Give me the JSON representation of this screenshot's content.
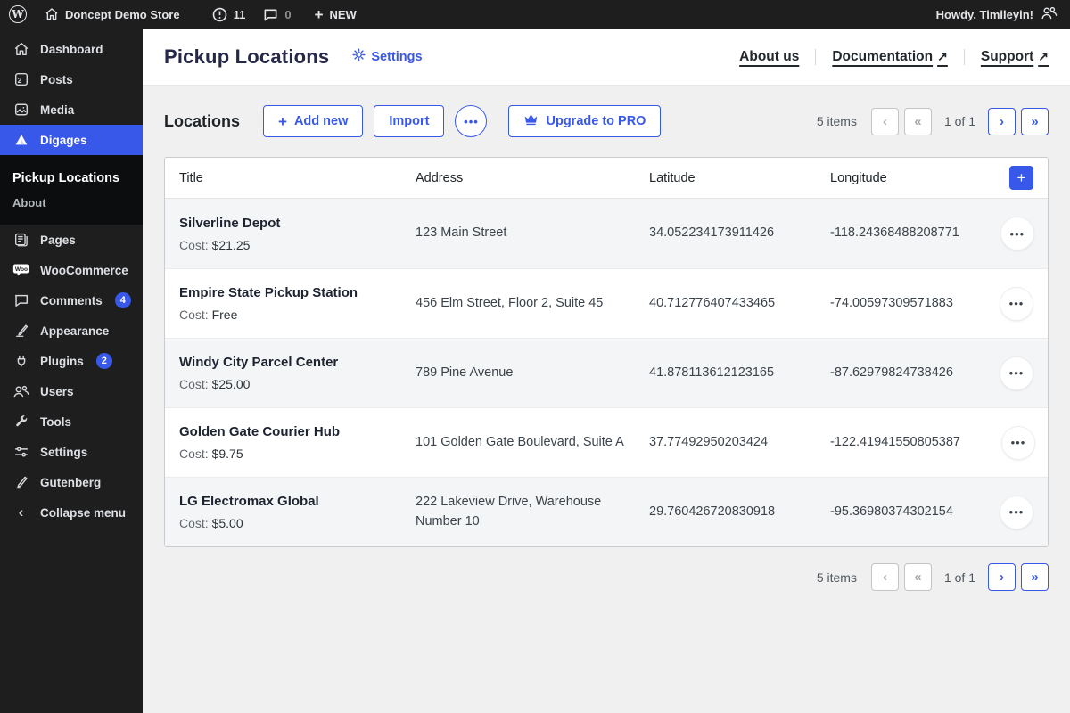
{
  "admin_bar": {
    "wp_logo": "W",
    "site_name": "Doncept Demo Store",
    "updates_count": "11",
    "comments_count": "0",
    "new_label": "NEW",
    "howdy": "Howdy, Timileyin!"
  },
  "sidebar": {
    "items": [
      {
        "label": "Dashboard"
      },
      {
        "label": "Posts"
      },
      {
        "label": "Media"
      },
      {
        "label": "Digages"
      },
      {
        "label": "Pages"
      },
      {
        "label": "WooCommerce"
      },
      {
        "label": "Comments",
        "badge": "4"
      },
      {
        "label": "Appearance"
      },
      {
        "label": "Plugins",
        "badge": "2"
      },
      {
        "label": "Users"
      },
      {
        "label": "Tools"
      },
      {
        "label": "Settings"
      },
      {
        "label": "Gutenberg"
      },
      {
        "label": "Collapse menu"
      }
    ],
    "submenu": [
      {
        "label": "Pickup Locations"
      },
      {
        "label": "About"
      }
    ]
  },
  "header": {
    "title": "Pickup Locations",
    "settings_label": "Settings",
    "nav": [
      {
        "label": "About us"
      },
      {
        "label": "Documentation"
      },
      {
        "label": "Support"
      }
    ]
  },
  "toolbar": {
    "heading": "Locations",
    "add_new_label": "Add new",
    "import_label": "Import",
    "upgrade_label": "Upgrade to PRO"
  },
  "pagination": {
    "items_text": "5 items",
    "page_text": "1 of 1"
  },
  "table": {
    "columns": [
      "Title",
      "Address",
      "Latitude",
      "Longitude"
    ],
    "cost_label": "Cost:",
    "rows": [
      {
        "title": "Silverline Depot",
        "cost": "$21.25",
        "address": "123 Main Street",
        "latitude": "34.052234173911426",
        "longitude": "-118.24368488208771"
      },
      {
        "title": "Empire State Pickup Station",
        "cost": "Free",
        "address": "456 Elm Street, Floor 2, Suite 45",
        "latitude": "40.712776407433465",
        "longitude": "-74.00597309571883"
      },
      {
        "title": "Windy City Parcel Center",
        "cost": "$25.00",
        "address": "789 Pine Avenue",
        "latitude": "41.878113612123165",
        "longitude": "-87.62979824738426"
      },
      {
        "title": "Golden Gate Courier Hub",
        "cost": "$9.75",
        "address": "101 Golden Gate Boulevard, Suite A",
        "latitude": "37.77492950203424",
        "longitude": "-122.41941550805387"
      },
      {
        "title": "LG Electromax Global",
        "cost": "$5.00",
        "address": "222 Lakeview Drive, Warehouse Number 10",
        "latitude": "29.760426720830918",
        "longitude": "-95.36980374302154"
      }
    ]
  },
  "icons": {
    "posts_badge": "2",
    "woo": "Woo",
    "ellipsis": "•••",
    "external_arrow": "↗",
    "plus": "+",
    "prev": "‹",
    "prev_double": "«",
    "next": "›",
    "next_double": "»",
    "collapse_chevron": "‹"
  },
  "colors": {
    "accent": "#3858e9",
    "admin_bar_bg": "#1e1e1e",
    "submenu_bg": "#0c0d0e",
    "content_bg": "#f0f0f1",
    "row_stripe": "#f4f5f6"
  }
}
